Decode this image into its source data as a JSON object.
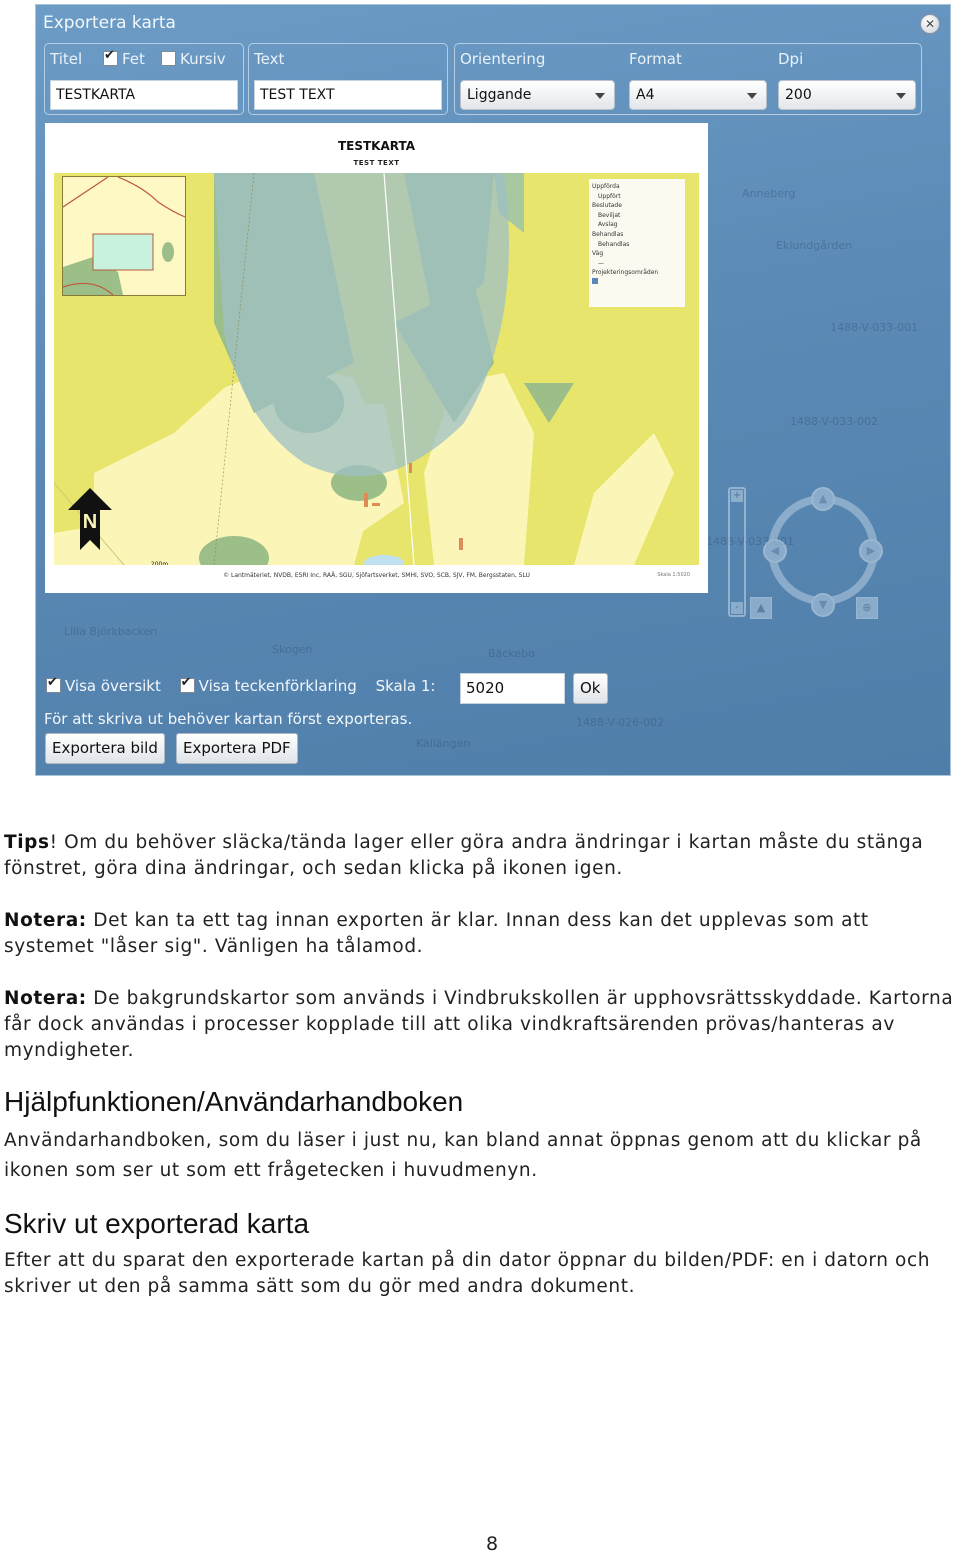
{
  "dialog": {
    "title": "Exportera karta",
    "close_icon": "close-circle-icon",
    "title_group": {
      "label": "Titel",
      "bold_label": "Fet",
      "bold_checked": true,
      "italic_label": "Kursiv",
      "italic_checked": false,
      "value": "TESTKARTA"
    },
    "text_group": {
      "label": "Text",
      "value": "TEST TEXT"
    },
    "orientation": {
      "label": "Orientering",
      "selected": "Liggande"
    },
    "format": {
      "label": "Format",
      "selected": "A4"
    },
    "dpi": {
      "label": "Dpi",
      "selected": "200"
    },
    "preview": {
      "title": "TESTKARTA",
      "subtitle": "TEST TEXT",
      "legend": {
        "groups": [
          {
            "heading": "Uppförda",
            "items": [
              "Uppfört"
            ]
          },
          {
            "heading": "Beslutade",
            "items": [
              "Beviljat",
              "Avslag"
            ]
          },
          {
            "heading": "Behandlas",
            "items": [
              "Behandlas"
            ]
          },
          {
            "heading": "Väg",
            "items": [
              ""
            ]
          },
          {
            "heading": "Projekteringsområden",
            "items": [
              ""
            ]
          }
        ]
      },
      "north_label": "N",
      "scalebar_label": "200m",
      "credits": "© Lantmäteriet, NVDB, ESRI Inc, RAÄ, SGU, Sjöfartsverket, SMHI, SVO, SCB, SJV, FM, Bergsstaten, SLU",
      "scale_note": "Skala 1:5020"
    },
    "map_labels": [
      "Anneberg",
      "Eklundgården",
      "1488-V-033-001",
      "1488-V-033-002",
      "1488-V-033-001",
      "1488-V-026-002",
      "Källängen",
      "Skogen",
      "Lilla Björkbacken",
      "Bäckebo"
    ],
    "show_overview": {
      "label": "Visa översikt",
      "checked": true
    },
    "show_legend": {
      "label": "Visa teckenförklaring",
      "checked": true
    },
    "scale": {
      "label": "Skala 1:",
      "value": "5020",
      "ok_label": "Ok"
    },
    "print_note": "För att skriva ut behöver kartan först exporteras.",
    "export_image_label": "Exportera bild",
    "export_pdf_label": "Exportera PDF",
    "nav": {
      "zoom_in": "+",
      "zoom_out": "-"
    }
  },
  "document": {
    "tips": {
      "lead": "Tips",
      "text": "! Om du behöver släcka/tända lager eller göra andra ändringar i kartan måste du stänga fönstret, göra dina ändringar, och sedan klicka på ikonen igen."
    },
    "note1": {
      "lead": "Notera:",
      "text": " Det kan ta ett tag innan exporten är klar. Innan dess kan det upplevas som att systemet \"låser sig\". Vänligen ha tålamod."
    },
    "note2": {
      "lead": "Notera:",
      "text": " De bakgrundskartor som används i Vindbrukskollen är upphovsrättsskyddade. Kartorna får dock användas i processer kopplade till att olika vindkraftsärenden prövas/hanteras av myndigheter."
    },
    "section1": {
      "heading": "Hjälpfunktionen/Användarhandboken",
      "body": "Användarhandboken, som du läser i just nu, kan bland annat öppnas genom att du klickar på ikonen som ser ut som ett frågetecken i huvudmenyn."
    },
    "section2": {
      "heading": "Skriv ut exporterad karta",
      "body": "Efter att du sparat den exporterade kartan på din dator öppnar du bilden/PDF: en i datorn och skriver ut den på samma sätt som du gör med andra dokument."
    },
    "page_number": "8"
  }
}
